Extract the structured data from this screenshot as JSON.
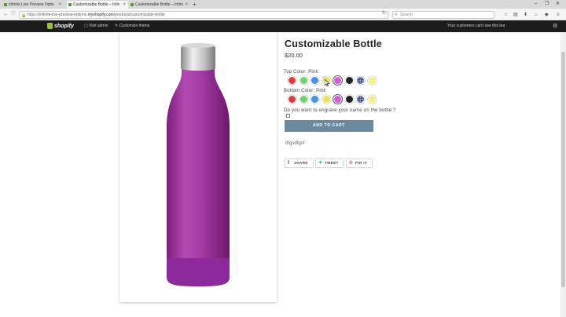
{
  "browser": {
    "tabs": [
      {
        "label": "Infinite Live Preview Optio"
      },
      {
        "label": "Customizable Bottle – Infin"
      },
      {
        "label": "Customizable Bottle – Infini"
      }
    ],
    "new_tab_icon": "plus-icon",
    "url_prefix": "https://infinite-live-preview-options.",
    "url_domain": "myshopify.com",
    "url_path": "/products/customizable-bottle",
    "search_placeholder": "Search"
  },
  "admin_bar": {
    "logo_text": "shopify",
    "visit_admin": "Visit admin",
    "customize_theme": "Customize theme",
    "notice": "Your customers can't see this bar"
  },
  "product": {
    "title": "Customizable Bottle",
    "price": "$20.00",
    "top_color_label": "Top Color: Pink",
    "bottom_color_label": "Bottom Color: Pink",
    "engrave_question": "Do you want to engrave your name on the bottle ?",
    "add_to_cart": "ADD TO CART",
    "description": "dfgsdfgsf",
    "share": {
      "facebook": "SHARE",
      "twitter": "TWEET",
      "pinterest": "PIN IT"
    },
    "swatch_colors": [
      "#e03a3a",
      "#6fd36f",
      "#4a8fe0",
      "#e8e45a",
      "#d65ad6",
      "#222222",
      "#2c3d7a",
      "#f2ea5a"
    ],
    "swatch_names": [
      "red",
      "green",
      "blue",
      "yellow",
      "pink",
      "black",
      "navy-pattern",
      "yellow-pattern"
    ],
    "selected_swatch": "pink",
    "bottle_color": "#a33aa3"
  }
}
